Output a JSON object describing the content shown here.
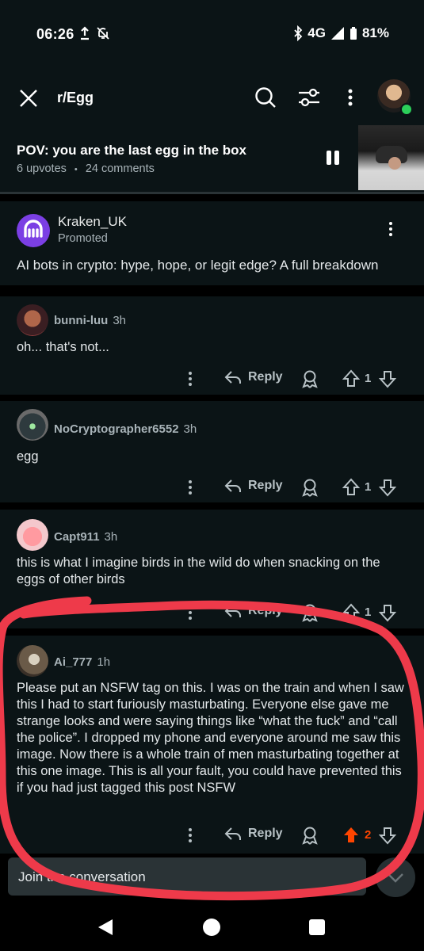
{
  "status_bar": {
    "time": "06:26",
    "network": "4G",
    "battery": "81%"
  },
  "header": {
    "subreddit": "r/Egg",
    "icons": [
      "close-icon",
      "search-icon",
      "filter-icon",
      "more-vertical-icon",
      "avatar"
    ]
  },
  "post": {
    "title": "POV: you are the last egg in the box",
    "upvotes": "6 upvotes",
    "separator": "•",
    "comments": "24 comments"
  },
  "ad": {
    "name": "Kraken_UK",
    "label": "Promoted",
    "text": "AI bots in crypto: hype, hope, or legit edge? A full breakdown"
  },
  "comments": [
    {
      "user": "bunni-luu",
      "age": "3h",
      "text": "oh... that's not...",
      "reply": "Reply",
      "votes": "1"
    },
    {
      "user": "NoCryptographer6552",
      "age": "3h",
      "text": "egg",
      "reply": "Reply",
      "votes": "1"
    },
    {
      "user": "Capt911",
      "age": "3h",
      "text": "this is what I imagine birds in the wild do when snacking on the eggs of other birds",
      "reply": "Reply",
      "votes": "1"
    },
    {
      "user": "Ai_777",
      "age": "1h",
      "text": "Please put an NSFW tag on this. I was on the train and when I saw this I had to start furiously masturbating. Everyone else gave me strange looks and were saying things like “what the fuck” and “call the police”. I dropped my phone and everyone around me saw this image. Now there is a whole train of men masturbating together at this one image. This is all your fault, you could have prevented this if you had just tagged this post NSFW",
      "reply": "Reply",
      "votes": "2"
    }
  ],
  "compose": {
    "placeholder": "Join the conversation"
  },
  "colors": {
    "background": "#0b1416",
    "upvote_active": "#ff4500",
    "annotation": "#ee3a4a",
    "ad_brand": "#7b3fe4"
  }
}
